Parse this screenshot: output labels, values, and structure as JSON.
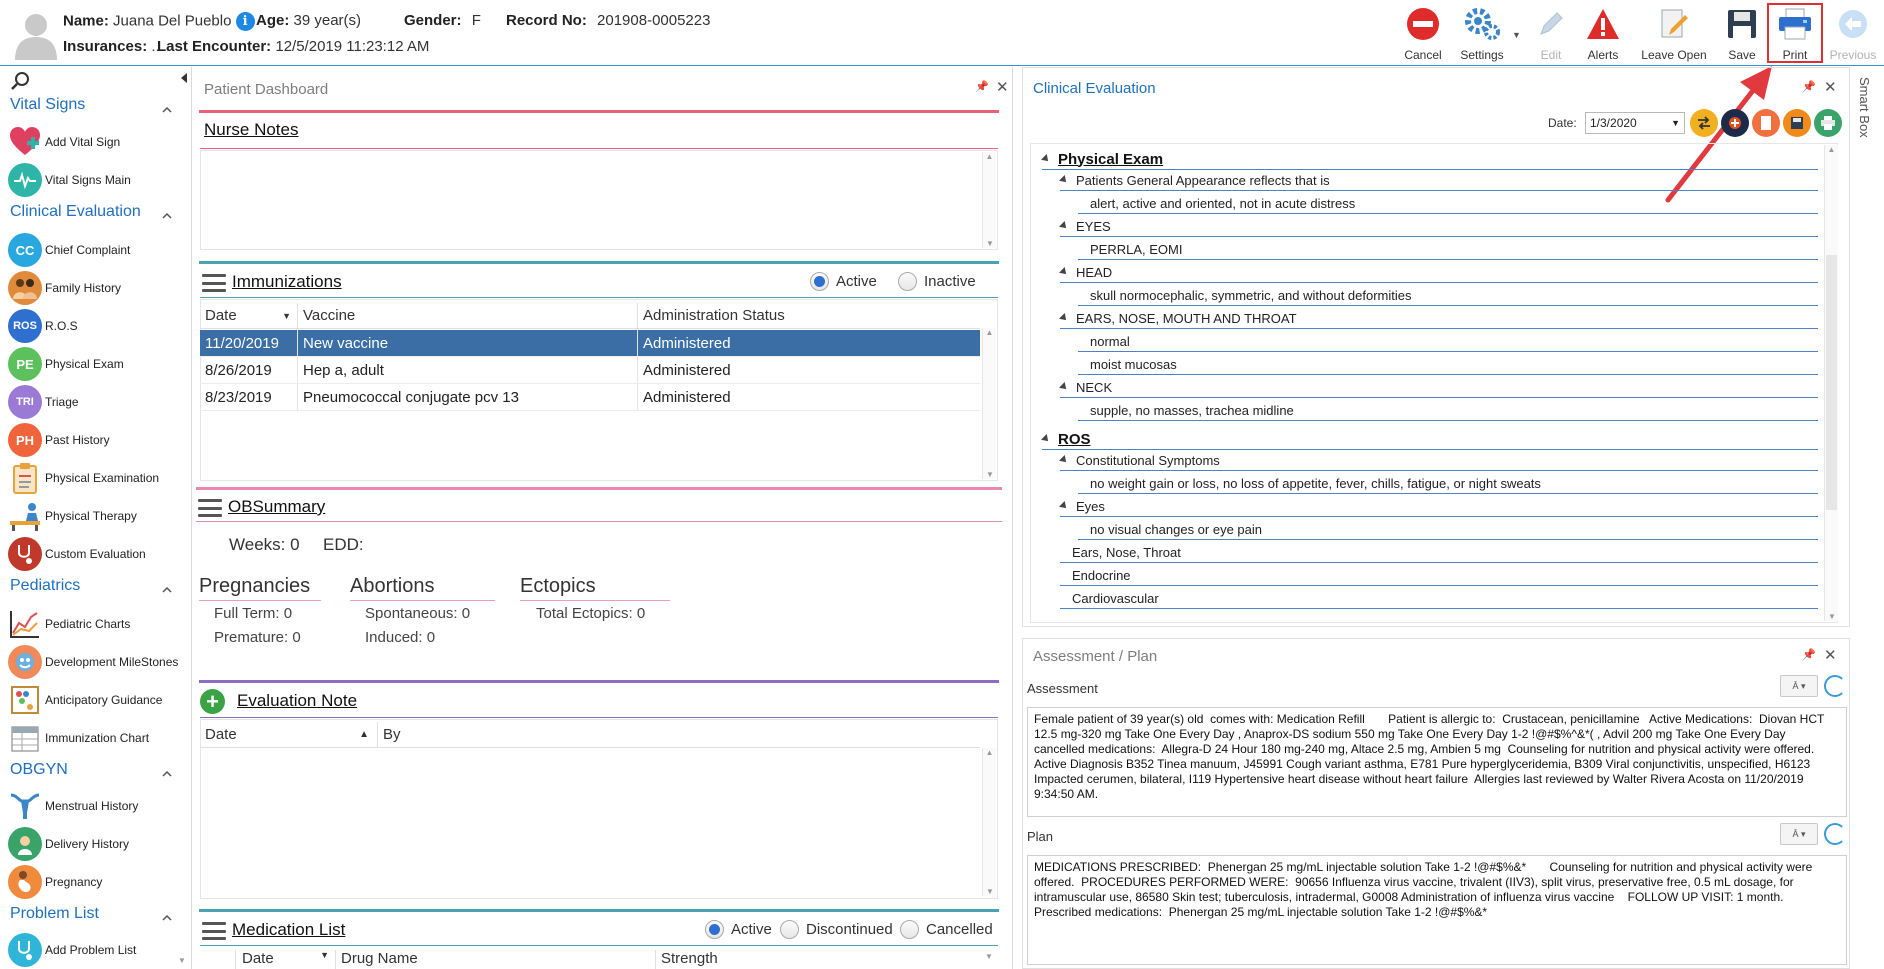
{
  "patient": {
    "name_label": "Name:",
    "name": "Juana Del Pueblo",
    "info_icon": "i",
    "age_label": "Age:",
    "age": "39 year(s)",
    "gender_label": "Gender:",
    "gender": "F",
    "record_label": "Record No:",
    "record_no": "201908-0005223",
    "insurances_label": "Insurances:",
    "insurances": "..",
    "last_encounter_label": "Last Encounter:",
    "last_encounter": "12/5/2019 11:23:12 AM"
  },
  "toolbar": {
    "cancel": "Cancel",
    "settings": "Settings",
    "edit": "Edit",
    "alerts": "Alerts",
    "leave_open": "Leave Open",
    "save": "Save",
    "print": "Print",
    "previous": "Previous"
  },
  "sidebar": {
    "vital_signs": {
      "title": "Vital Signs",
      "items": [
        {
          "label": "Add Vital Sign",
          "icon": "heart-plus-icon"
        },
        {
          "label": "Vital Signs Main",
          "icon": "heartbeat-icon"
        }
      ]
    },
    "clinical_evaluation": {
      "title": "Clinical Evaluation",
      "items": [
        {
          "label": "Chief Complaint",
          "badge": "CC",
          "color": "#29a8e0"
        },
        {
          "label": "Family History",
          "badge": "",
          "color": "#e08a3c"
        },
        {
          "label": "R.O.S",
          "badge": "ROS",
          "color": "#2f6fd0"
        },
        {
          "label": "Physical Exam",
          "badge": "PE",
          "color": "#5cc15c"
        },
        {
          "label": "Triage",
          "badge": "TRI",
          "color": "#9b7ad6"
        },
        {
          "label": "Past History",
          "badge": "PH",
          "color": "#f0643c"
        },
        {
          "label": "Physical Examination",
          "badge": "",
          "color": "#e8a23a"
        },
        {
          "label": "Physical Therapy",
          "badge": "",
          "color": "#3a86c8"
        },
        {
          "label": "Custom Evaluation",
          "badge": "",
          "color": "#c0392b"
        }
      ]
    },
    "pediatrics": {
      "title": "Pediatrics",
      "items": [
        {
          "label": "Pediatric Charts"
        },
        {
          "label": "Development MileStones"
        },
        {
          "label": "Anticipatory Guidance"
        },
        {
          "label": "Immunization Chart"
        }
      ]
    },
    "obgyn": {
      "title": "OBGYN",
      "items": [
        {
          "label": "Menstrual History"
        },
        {
          "label": "Delivery History"
        },
        {
          "label": "Pregnancy"
        }
      ]
    },
    "problem_list": {
      "title": "Problem List",
      "items": [
        {
          "label": "Add Problem List"
        }
      ]
    }
  },
  "dashboard": {
    "title": "Patient Dashboard",
    "nurse_notes": {
      "title": "Nurse Notes"
    },
    "immunizations": {
      "title": "Immunizations",
      "filter_active": "Active",
      "filter_inactive": "Inactive",
      "columns": [
        "Date",
        "Vaccine",
        "Administration Status"
      ],
      "rows": [
        {
          "date": "11/20/2019",
          "vaccine": "New vaccine",
          "status": "Administered"
        },
        {
          "date": "8/26/2019",
          "vaccine": "Hep a, adult",
          "status": "Administered"
        },
        {
          "date": "8/23/2019",
          "vaccine": "Pneumococcal conjugate pcv 13",
          "status": "Administered"
        }
      ]
    },
    "ob_summary": {
      "title": "OBSummary",
      "weeks_label": "Weeks:",
      "weeks": "0",
      "edd_label": "EDD:",
      "pregnancies_title": "Pregnancies",
      "full_term_label": "Full Term:",
      "full_term": "0",
      "premature_label": "Premature:",
      "premature": "0",
      "abortions_title": "Abortions",
      "spontaneous_label": "Spontaneous:",
      "spontaneous": "0",
      "induced_label": "Induced:",
      "induced": "0",
      "ectopics_title": "Ectopics",
      "total_ectopics_label": "Total Ectopics:",
      "total_ectopics": "0"
    },
    "evaluation_note": {
      "title": "Evaluation Note",
      "columns": [
        "Date",
        "By"
      ]
    },
    "medication_list": {
      "title": "Medication List",
      "filter_active": "Active",
      "filter_discontinued": "Discontinued",
      "filter_cancelled": "Cancelled",
      "columns": [
        "Date",
        "Drug Name",
        "Strength"
      ]
    }
  },
  "clinical_evaluation": {
    "title": "Clinical Evaluation",
    "date_label": "Date:",
    "date": "1/3/2020",
    "smart_box": "Smart Box",
    "tree": [
      {
        "level": 0,
        "text": "Physical Exam"
      },
      {
        "level": 1,
        "text": "Patients General Appearance reflects that is"
      },
      {
        "level": 2,
        "text": "alert, active and oriented, not in acute distress"
      },
      {
        "level": 1,
        "text": "EYES"
      },
      {
        "level": 2,
        "text": "PERRLA, EOMI"
      },
      {
        "level": 1,
        "text": "HEAD"
      },
      {
        "level": 2,
        "text": "skull normocephalic, symmetric, and without deformities"
      },
      {
        "level": 1,
        "text": "EARS, NOSE, MOUTH AND THROAT"
      },
      {
        "level": 2,
        "text": "normal"
      },
      {
        "level": 2,
        "text": "moist mucosas"
      },
      {
        "level": 1,
        "text": "NECK"
      },
      {
        "level": 2,
        "text": "supple, no masses, trachea midline"
      },
      {
        "level": 0,
        "text": "ROS"
      },
      {
        "level": 1,
        "text": "Constitutional Symptoms"
      },
      {
        "level": 2,
        "text": "no weight gain or loss, no loss of appetite, fever, chills, fatigue, or night sweats"
      },
      {
        "level": 1,
        "text": "Eyes"
      },
      {
        "level": 2,
        "text": "no visual changes or eye pain"
      },
      {
        "level": 3,
        "text": "Ears, Nose, Throat"
      },
      {
        "level": 3,
        "text": "Endocrine"
      },
      {
        "level": 3,
        "text": "Cardiovascular"
      }
    ]
  },
  "assessment_plan": {
    "title": "Assessment / Plan",
    "assessment_label": "Assessment",
    "assessment_text": "Female patient of 39 year(s) old  comes with: Medication Refill       Patient is allergic to:  Crustacean, penicillamine   Active Medications:  Diovan HCT 12.5 mg-320 mg Take One Every Day , Anaprox-DS sodium 550 mg Take One Every Day 1-2 !@#$%^&*( , Advil 200 mg Take One Every Day      cancelled medications:  Allegra-D 24 Hour 180 mg-240 mg, Altace 2.5 mg, Ambien 5 mg  Counseling for nutrition and physical activity were offered.  Active Diagnosis B352 Tinea manuum, J45991 Cough variant asthma, E781 Pure hyperglyceridemia, B309 Viral conjunctivitis, unspecified, H6123 Impacted cerumen, bilateral, I119 Hypertensive heart disease without heart failure  Allergies last reviewed by Walter Rivera Acosta on 11/20/2019 9:34:50 AM.",
    "plan_label": "Plan",
    "plan_text": "MEDICATIONS PRESCRIBED:  Phenergan 25 mg/mL injectable solution Take 1-2 !@#$%&*       Counseling for nutrition and physical activity were offered.  PROCEDURES PERFORMED WERE:  90656 Influenza virus vaccine, trivalent (IIV3), split virus, preservative free, 0.5 mL dosage, for intramuscular use, 86580 Skin test; tuberculosis, intradermal, G0008 Administration of influenza virus vaccine    FOLLOW UP VISIT: 1 month.  Prescribed medications:  Phenergan 25 mg/mL injectable solution Take 1-2 !@#$%&*"
  },
  "colors": {
    "accent": "#1f6fbf",
    "selected_row": "#3a6ea5",
    "highlight_box": "#e03131",
    "arrow": "#e0393e"
  }
}
